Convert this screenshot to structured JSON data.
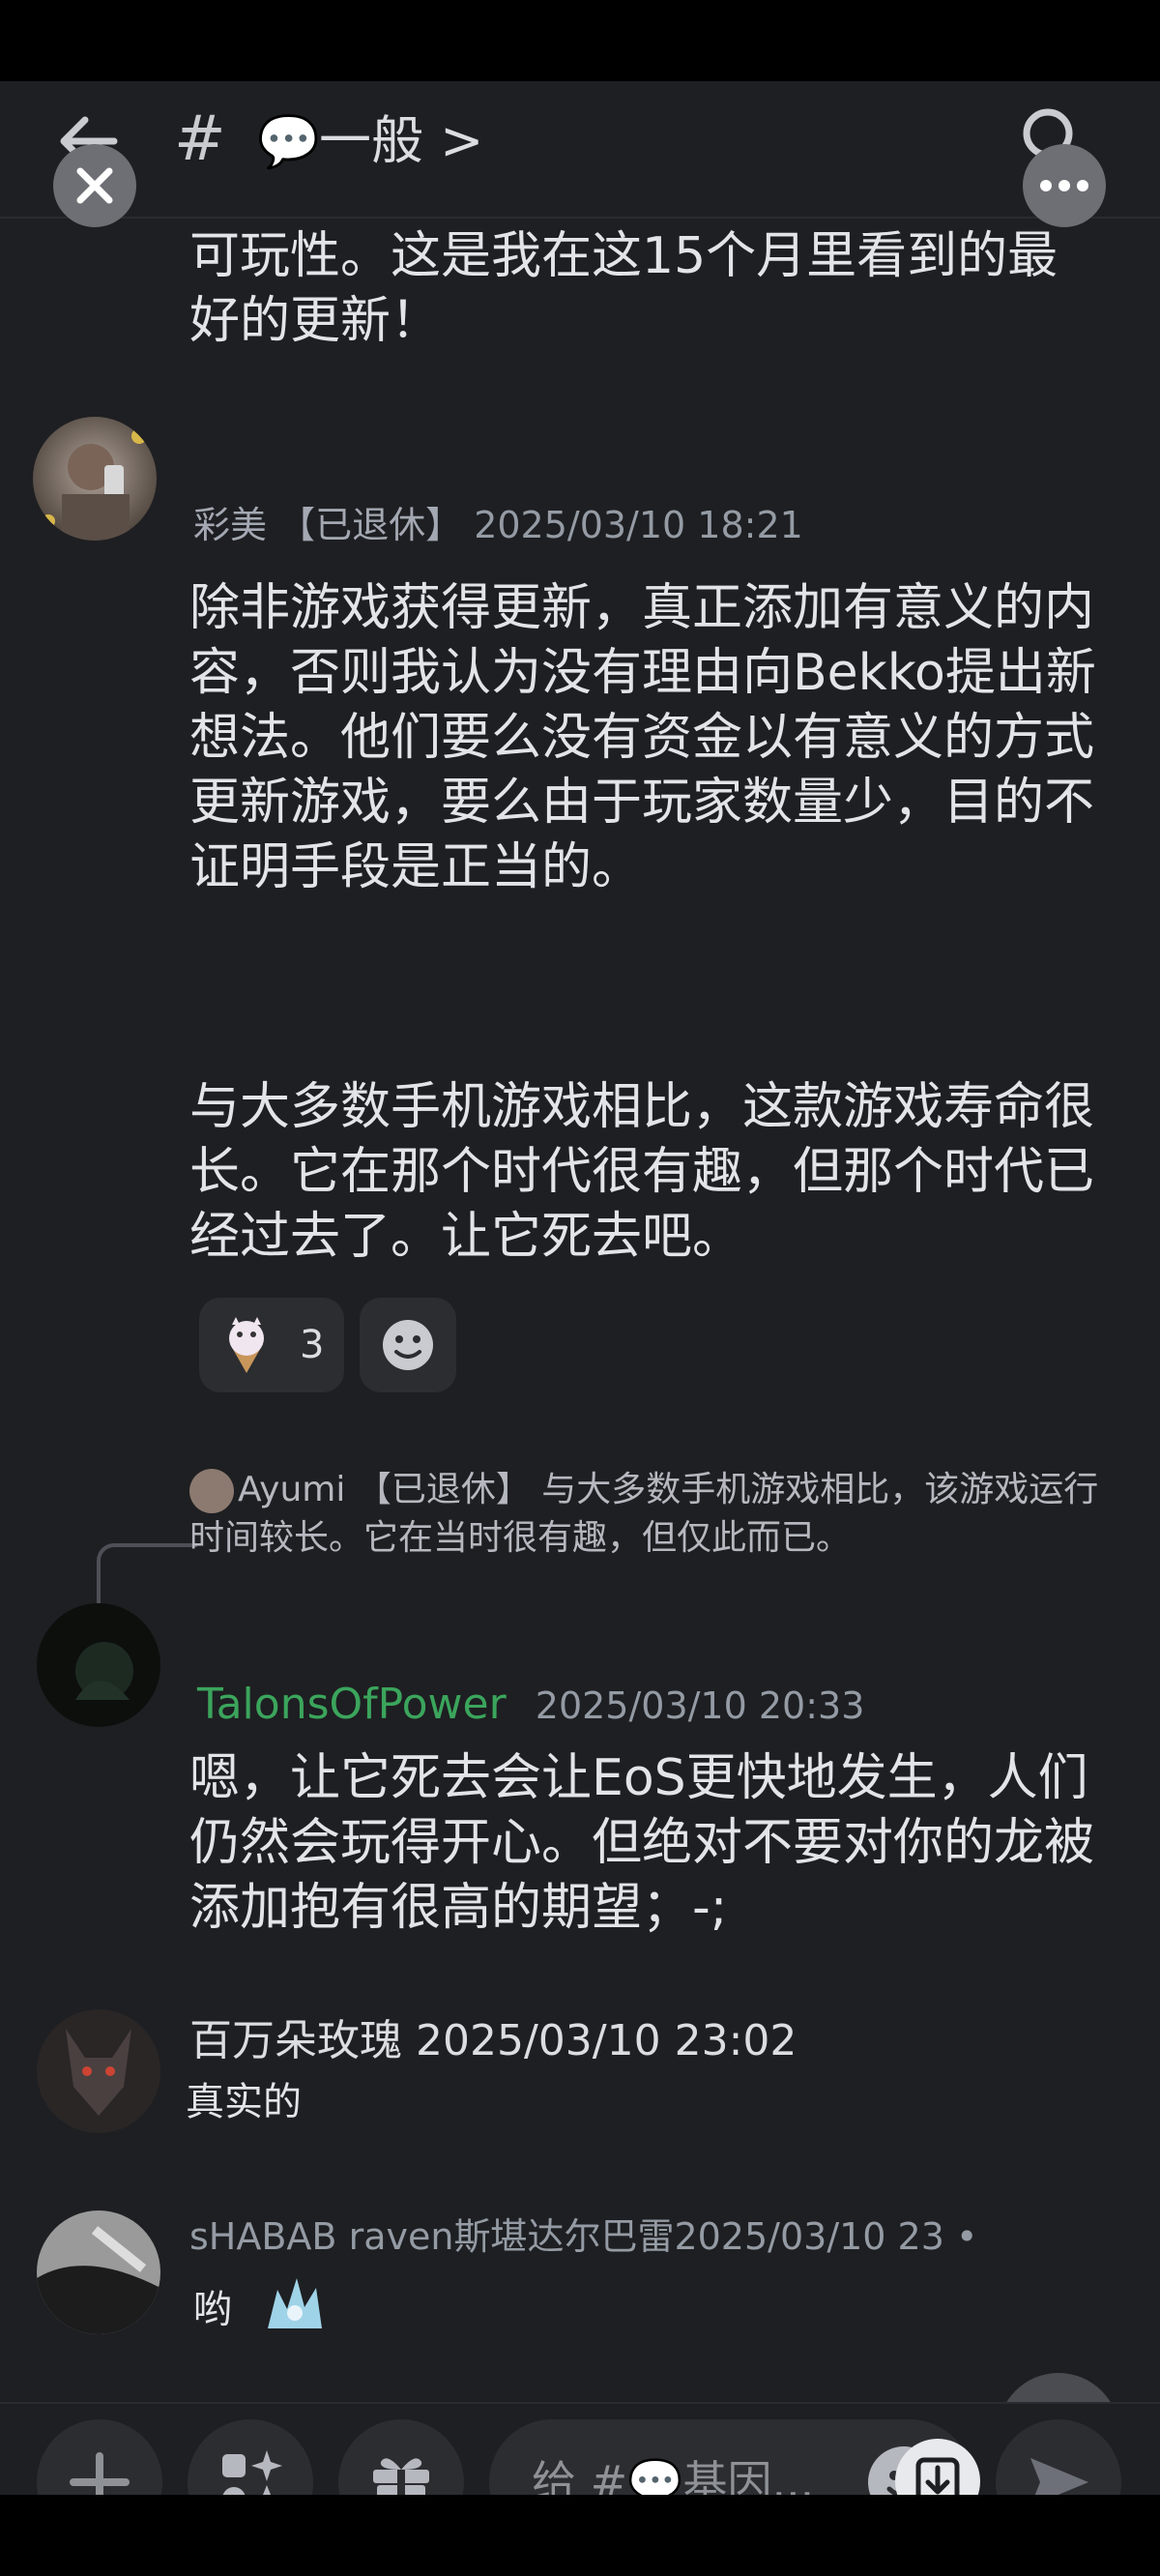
{
  "header": {
    "back_icon": "arrow-left-icon",
    "hash": "#",
    "channel_emoji": "💬",
    "channel_name": "一般 >",
    "search_icon": "search-icon"
  },
  "overlay": {
    "close_icon": "close-icon",
    "more_icon": "more-icon"
  },
  "messages": [
    {
      "continuation": "可玩性。这是我在这15个月里看到的最好的更新！"
    },
    {
      "author": "彩美 【已退休】",
      "timestamp": "2025/03/10 18:21",
      "paragraph1": "除非游戏获得更新，真正添加有意义的内容，否则我认为没有理由向Bekko提出新想法。他们要么没有资金以有意义的方式更新游戏，要么由于玩家数量少，目的不证明手段是正当的。",
      "paragraph2": "与大多数手机游戏相比，这款游戏寿命很长。它在那个时代很有趣，但那个时代已经过去了。让它死去吧。",
      "reactions": [
        {
          "icon": "ice-cream-cat-emoji",
          "count": "3"
        },
        {
          "icon": "add-reaction-icon",
          "count": ""
        }
      ]
    },
    {
      "reply_preview": "Ayumi 【已退休】 与大多数手机游戏相比，该游戏运行时间较长。它在当时很有趣，但仅此而已。",
      "author": "TalonsOfPower",
      "timestamp": "2025/03/10 20:33",
      "text": "嗯，让它死去会让EoS更快地发生，人们仍然会玩得开心。但绝对不要对你的龙被添加抱有很高的期望；-;"
    },
    {
      "author": "百万朵玫瑰",
      "timestamp": "2025/03/10 23:02",
      "text": "真实的"
    },
    {
      "author": "sHABAB raven斯堪达尔巴雷",
      "timestamp": "2025/03/10 23 •",
      "text": "哟"
    }
  ],
  "composer": {
    "plus_icon": "plus-icon",
    "apps_icon": "apps-icon",
    "gift_icon": "gift-icon",
    "placeholder": "给 #💬基因...",
    "emoji_icon": "emoji-icon",
    "send_icon": "send-icon"
  },
  "colors": {
    "background": "#1e1f22",
    "author_green": "#3ba55c",
    "text": "#dcdde1",
    "muted": "#949ba4"
  }
}
